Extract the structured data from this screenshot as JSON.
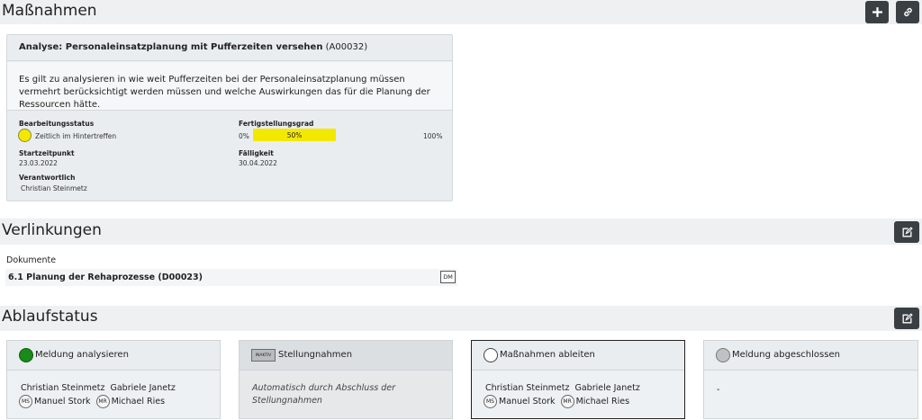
{
  "massnahmen": {
    "title": "Maßnahmen",
    "add_icon": "plus-icon",
    "link_icon": "link-icon"
  },
  "analyse": {
    "title_bold": "Analyse: Personaleinsatzplanung mit Pufferzeiten versehen",
    "title_id": "(A00032)",
    "description": "Es gilt zu analysieren in wie weit Pufferzeiten bei der Personaleinsatzplanung müssen vermehrt berücksichtigt werden müssen und welche Auswirkungen das für die Planung der Ressourcen hätte.",
    "status_label": "Bearbeitungsstatus",
    "status_value": "Zeitlich im Hintertreffen",
    "status_color": "#f3e800",
    "progress_label": "Fertigstellungsgrad",
    "progress_min": "0%",
    "progress_max": "100%",
    "progress_text": "50%",
    "progress_fraction": 0.49,
    "start_label": "Startzeitpunkt",
    "start_value": "23.03.2022",
    "due_label": "Fälligkeit",
    "due_value": "30.04.2022",
    "owner_label": "Verantwortlich",
    "owner_value": "Christian Steinmetz"
  },
  "verlinkungen": {
    "title": "Verlinkungen",
    "edit_icon": "edit-icon",
    "documents_label": "Dokumente",
    "document_name": "6.1 Planung der Rehaprozesse (D00023)",
    "document_badge": "DM"
  },
  "ablaufstatus": {
    "title": "Ablaufstatus",
    "edit_icon": "edit-icon",
    "steps": [
      {
        "title": "Meldung analysieren",
        "state_color": "#1a8a1a",
        "person1": "Christian Steinmetz",
        "person2": "Gabriele Janetz",
        "chip1": "MS",
        "person3": "Manuel Stork",
        "chip2": "MR",
        "person4": "Michael Ries"
      },
      {
        "badge": "INAKTIV",
        "title": "Stellungnahmen",
        "note": "Automatisch durch Abschluss der Stellungnahmen"
      },
      {
        "title": "Maßnahmen ableiten",
        "person1": "Christian Steinmetz",
        "person2": "Gabriele Janetz",
        "chip1": "MS",
        "person3": "Manuel Stork",
        "chip2": "MR",
        "person4": "Michael Ries"
      },
      {
        "title": "Meldung abgeschlossen",
        "dash": "-"
      }
    ]
  }
}
